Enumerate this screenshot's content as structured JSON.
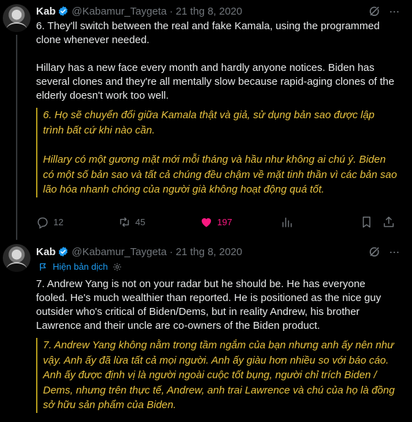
{
  "tweets": [
    {
      "name": "Kab",
      "handle": "@Kabamur_Taygeta",
      "separator": "·",
      "date": "21 thg 8, 2020",
      "more": "···",
      "body": [
        "6. They'll switch between the real and fake Kamala, using the programmed clone whenever needed.",
        "Hillary has a new face every month and hardly anyone notices. Biden has several clones and they're all mentally slow because rapid-aging clones of the elderly doesn't work too well."
      ],
      "translation": [
        "6. Họ sẽ chuyển đổi giữa Kamala thật và giả, sử dụng bản sao được lập trình bất cứ khi nào cần.",
        "Hillary có một gương mặt mới mỗi tháng và hầu như không ai chú ý. Biden có một số bản sao và tất cả chúng đều chậm về mặt tinh thần vì các bản sao lão hóa nhanh chóng của người già không hoạt động quá tốt."
      ],
      "stats": {
        "replies": "12",
        "reposts": "45",
        "likes": "197"
      }
    },
    {
      "name": "Kab",
      "handle": "@Kabamur_Taygeta",
      "separator": "·",
      "date": "21 thg 8, 2020",
      "more": "···",
      "show_translation": "Hiện bản dịch",
      "body": [
        "7. Andrew Yang is not on your radar but he should be. He has everyone fooled. He's much wealthier than reported. He is positioned as the nice guy outsider who's critical of Biden/Dems, but in reality Andrew, his brother Lawrence and their uncle are co-owners of the Biden product."
      ],
      "translation": [
        "7. Andrew Yang không nằm trong tầm ngắm của bạn nhưng anh ấy nên như vậy. Anh ấy đã lừa tất cả mọi người. Anh ấy giàu hơn nhiều so với báo cáo. Anh ấy được định vị là người ngoài cuộc tốt bụng, người chỉ trích Biden / Dems, nhưng trên thực tế, Andrew, anh trai Lawrence và chú của họ là đồng sở hữu sản phẩm của Biden."
      ]
    }
  ],
  "colors": {
    "background": "#000000",
    "text": "#e7e9ea",
    "muted": "#71767b",
    "accent": "#1d9bf0",
    "like": "#f91880",
    "translation": "#e8c340"
  },
  "icons": [
    "avatar",
    "verified-badge-icon",
    "grok-icon",
    "more-icon",
    "translate-icon",
    "gear-icon",
    "reply-icon",
    "repost-icon",
    "like-icon",
    "views-icon",
    "bookmark-icon",
    "share-icon"
  ]
}
